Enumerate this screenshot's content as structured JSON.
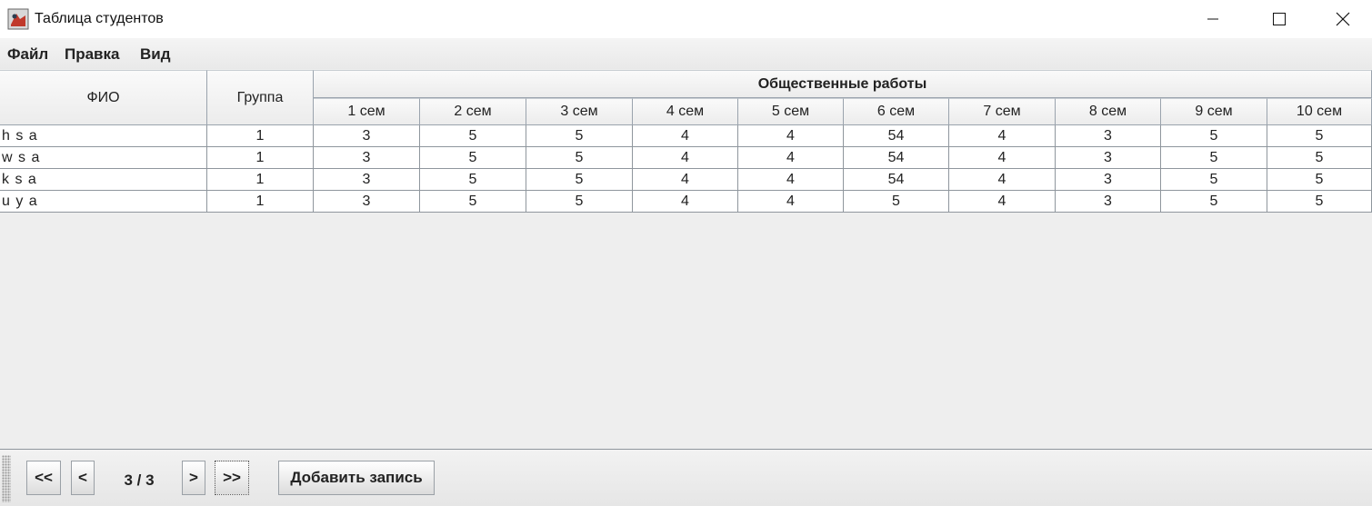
{
  "window": {
    "title": "Таблица студентов"
  },
  "menu": [
    "Файл",
    "Правка",
    "Вид"
  ],
  "table": {
    "headers": {
      "name": "ФИО",
      "group": "Группа",
      "group_title": "Общественные работы",
      "semesters": [
        "1 сем",
        "2 сем",
        "3 сем",
        "4 сем",
        "5 сем",
        "6 сем",
        "7 сем",
        "8 сем",
        "9 сем",
        "10 сем"
      ]
    },
    "rows": [
      {
        "name": "h s a",
        "group": "1",
        "values": [
          "3",
          "5",
          "5",
          "4",
          "4",
          "54",
          "4",
          "3",
          "5",
          "5"
        ]
      },
      {
        "name": "w s a",
        "group": "1",
        "values": [
          "3",
          "5",
          "5",
          "4",
          "4",
          "54",
          "4",
          "3",
          "5",
          "5"
        ]
      },
      {
        "name": "k s a",
        "group": "1",
        "values": [
          "3",
          "5",
          "5",
          "4",
          "4",
          "54",
          "4",
          "3",
          "5",
          "5"
        ]
      },
      {
        "name": "u y a",
        "group": "1",
        "values": [
          "3",
          "5",
          "5",
          "4",
          "4",
          "5",
          "4",
          "3",
          "5",
          "5"
        ]
      }
    ]
  },
  "pager": {
    "first_label": "<<",
    "prev_label": "<",
    "page_text": "3 / 3",
    "next_label": ">",
    "last_label": ">>",
    "add_label": "Добавить запись"
  }
}
